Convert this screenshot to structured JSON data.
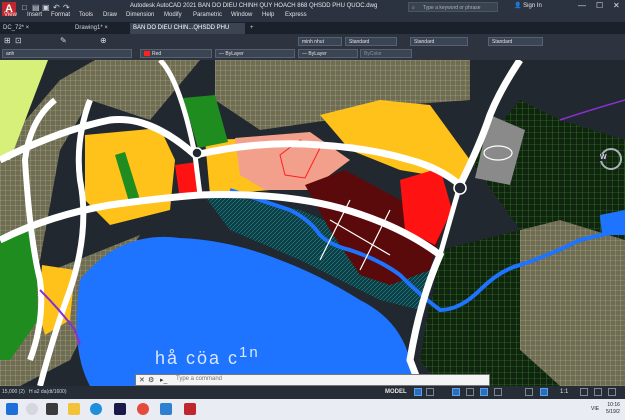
{
  "app": {
    "title": "Autodesk AutoCAD 2021   BAN DO DIEU CHINH QUY HOACH 868 QHSDD PHU QUOC.dwg",
    "search_placeholder": "Type a keyword or phrase",
    "sign_in": "Sign In"
  },
  "menu": [
    "View",
    "Insert",
    "Format",
    "Tools",
    "Draw",
    "Dimension",
    "Modify",
    "Parametric",
    "Window",
    "Help",
    "Express"
  ],
  "tabs": [
    {
      "label": "DC_72*",
      "active": false
    },
    {
      "label": "Drawing1*",
      "active": false
    },
    {
      "label": "BAN DO DIEU CHIN...QHSDD PHU QUOC*",
      "active": true
    }
  ],
  "properties": {
    "layer": "anh",
    "color": "Red",
    "linetype": "ByLayer",
    "lineweight": "ByLayer",
    "plotstyle": "ByColor",
    "textstyle": "minh nhut",
    "dimstyle": "Standard",
    "tablestyle": "Standard",
    "mleaderstyle": "Standard"
  },
  "drawing": {
    "label_text": "hå cöa c",
    "label_sup": "1n",
    "colors": {
      "background": "#212830",
      "water": "#1e73ff",
      "road": "#ffffff",
      "residential": "#ffc21a",
      "green": "#1e8c1e",
      "commercial": "#f2a08c",
      "special": "#5a0a0a",
      "public": "#ff1212",
      "hatch": "#8a8a6a",
      "grid": "#3a9a2a"
    }
  },
  "command": {
    "prompt": "Type a command"
  },
  "status": {
    "coords": "15,000 (2)",
    "layout_hint": "H a2 da(dt/1600)",
    "model": "MODEL",
    "scale": "1:1"
  },
  "taskbar": {
    "language": "VIE",
    "time": "10:16",
    "date": "5/19/2"
  }
}
